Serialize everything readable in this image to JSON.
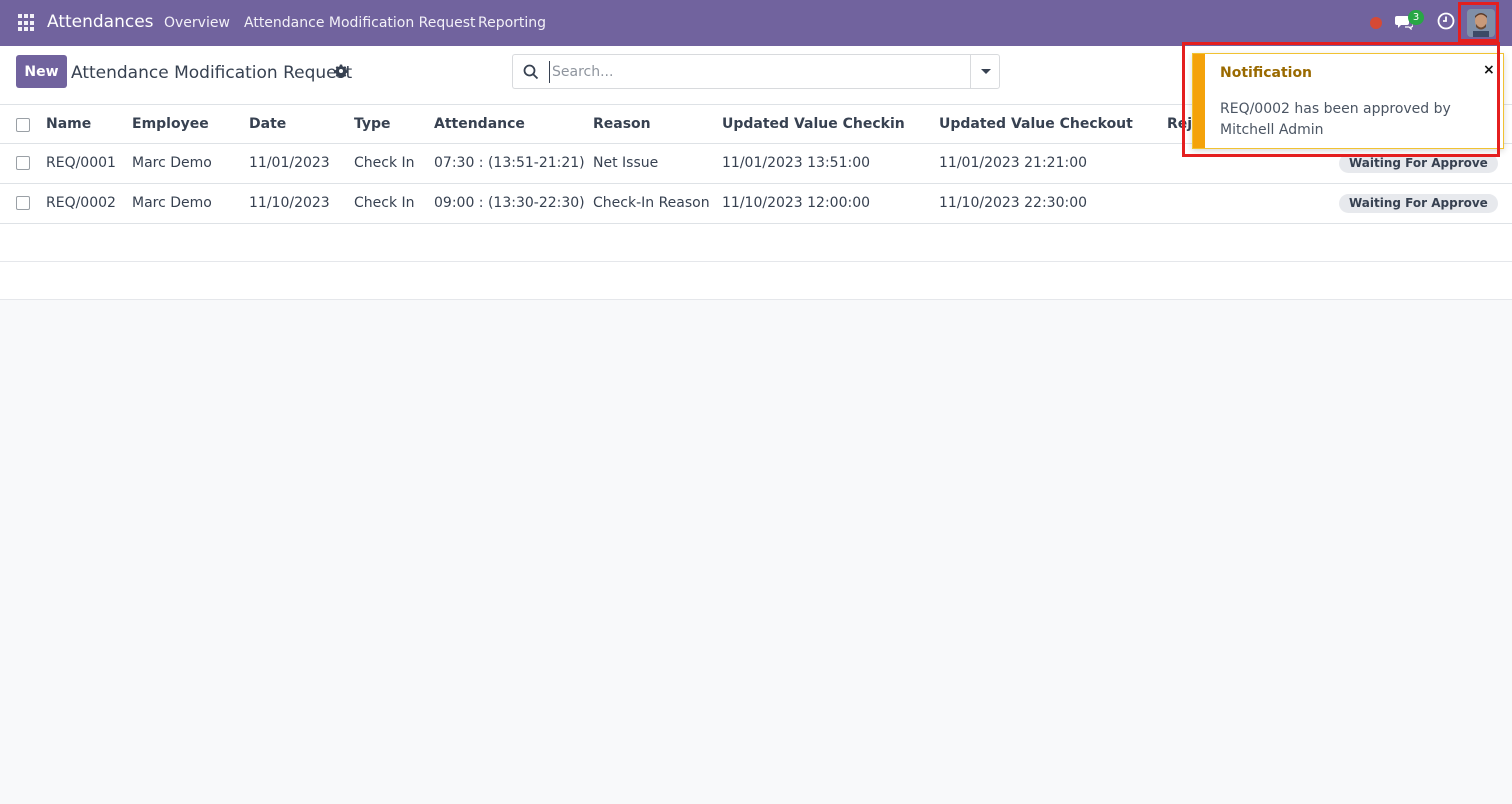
{
  "navbar": {
    "brand": "Attendances",
    "links": [
      "Overview",
      "Attendance Modification Request",
      "Reporting"
    ],
    "chat_count": "3"
  },
  "control": {
    "new_label": "New",
    "title": "Attendance Modification Request",
    "search_placeholder": "Search..."
  },
  "table": {
    "headers": [
      "Name",
      "Employee",
      "Date",
      "Type",
      "Attendance",
      "Reason",
      "Updated Value Checkin",
      "Updated Value Checkout",
      "Reje"
    ],
    "rows": [
      {
        "name": "REQ/0001",
        "employee": "Marc Demo",
        "date": "11/01/2023",
        "type": "Check In",
        "attendance": "07:30 : (13:51-21:21)",
        "reason": "Net Issue",
        "checkin": "11/01/2023 13:51:00",
        "checkout": "11/01/2023 21:21:00",
        "status": "Waiting For Approve"
      },
      {
        "name": "REQ/0002",
        "employee": "Marc Demo",
        "date": "11/10/2023",
        "type": "Check In",
        "attendance": "09:00 : (13:30-22:30)",
        "reason": "Check-In Reason",
        "checkin": "11/10/2023 12:00:00",
        "checkout": "11/10/2023 22:30:00",
        "status": "Waiting For Approve"
      }
    ]
  },
  "notification": {
    "title": "Notification",
    "close": "×",
    "message": "REQ/0002 has been approved by Mitchell Admin"
  },
  "colors": {
    "brand": "#71639e",
    "warning": "#f4a20a",
    "highlight": "#e41f1f"
  }
}
